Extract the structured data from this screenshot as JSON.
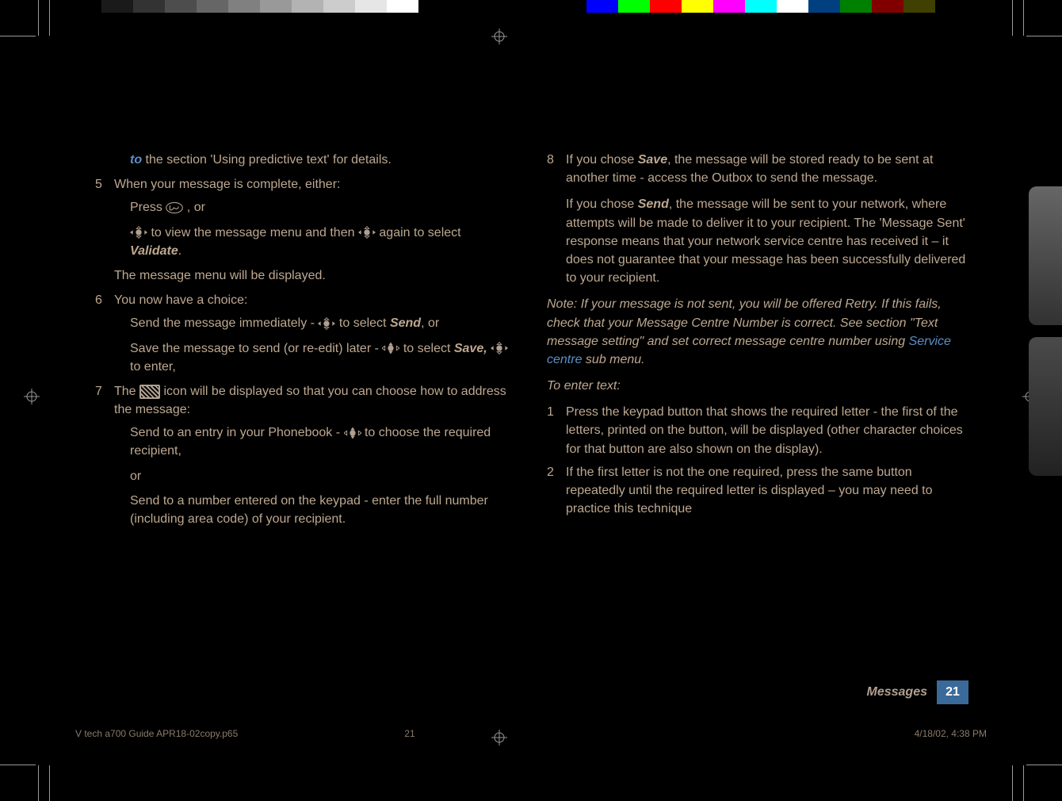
{
  "header": {
    "gray_swatches": [
      "#000000",
      "#1a1a1a",
      "#333333",
      "#4d4d4d",
      "#666666",
      "#808080",
      "#999999",
      "#b3b3b3",
      "#cccccc",
      "#e6e6e6",
      "#ffffff"
    ],
    "color_swatches": [
      "#0000ff",
      "#00ff00",
      "#ff0000",
      "#ffff00",
      "#ff00ff",
      "#00ffff",
      "#ffffff",
      "#004080",
      "#008000",
      "#800000",
      "#404000"
    ]
  },
  "left": {
    "line_to_prefix": "to",
    "line_to_rest": "  the section 'Using predictive text' for details.",
    "step5_num": "5",
    "step5_txt": "When your message is complete, either:",
    "step5_sub1_a": "Press ",
    "step5_sub1_b": ", or",
    "step5_sub2_a": " to view the message menu and then ",
    "step5_sub2_b": " again to select ",
    "step5_sub2_c": "Validate",
    "step5_sub2_d": ".",
    "menu_line": "The message menu will be displayed.",
    "step6_num": "6",
    "step6_txt": "You now  have a choice:",
    "step6_sub1_a": "Send the message immediately - ",
    "step6_sub1_b": " to select ",
    "step6_sub1_c": "Send",
    "step6_sub1_d": ", or",
    "step6_sub2_a": "Save the message to send (or re-edit) later - ",
    "step6_sub2_b": " to select ",
    "step6_sub2_c": "Save,",
    "step6_sub2_d": " ",
    "step6_sub2_e": " to enter,",
    "step7_num": "7",
    "step7_a": "The ",
    "step7_b": " icon will be displayed so that you can choose how to address the message:",
    "step7_sub1_a": "Send to an entry in your Phonebook - ",
    "step7_sub1_b": " to choose the required recipient,",
    "step7_or": "or",
    "step7_sub2": "Send to a number entered on the keypad - enter the full number (including area code) of your recipient."
  },
  "right": {
    "step8_num": "8",
    "step8_a": "If you chose ",
    "step8_b": "Save",
    "step8_c": ", the message will be stored ready to be sent at another time - access the Outbox to send the message.",
    "step8_d": "If you chose ",
    "step8_e": "Send",
    "step8_f": ", the message will be sent to your network, where attempts will be made to deliver it to your recipient. The 'Message Sent' response means that your network service centre has received it – it does not guarantee that your message has been successfully delivered to your recipient.",
    "note_a": "Note: If your message is not sent, you will be offered Retry. If this fails, check that your Message Centre Number is correct. See section \"Text message setting\" and set correct message centre number using ",
    "note_link": "Service centre",
    "note_b": " sub menu.",
    "enter_heading": "To enter text:",
    "e1_num": "1",
    "e1_txt": "Press the keypad button that shows the required letter - the first of the letters, printed on the button, will be displayed (other character choices for that button are also shown on the display).",
    "e2_num": "2",
    "e2_txt": "If the first letter is not the one required, press the same button repeatedly until the required letter is displayed – you may need to practice this technique"
  },
  "footer": {
    "section": "Messages",
    "page_number": "21",
    "print_file": "V tech a700 Guide APR18-02copy.p65",
    "print_page": "21",
    "print_date": "4/18/02, 4:38 PM"
  }
}
